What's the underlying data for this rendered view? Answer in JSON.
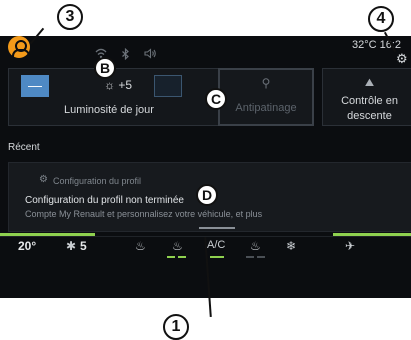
{
  "callouts": {
    "n3": "3",
    "n4": "4",
    "b": "B",
    "c": "C",
    "d": "D",
    "n1": "1"
  },
  "status": {
    "temperature_time": "32°C 16:2",
    "icons": [
      "wifi-icon",
      "bluetooth-icon",
      "volume-icon"
    ]
  },
  "tiles": {
    "luminosity": {
      "minus": "—",
      "value": "☼ +5",
      "label": "Luminosité de jour"
    },
    "antipatinage": {
      "label": "Antipatinage"
    },
    "descente": {
      "label_line1": "Contrôle en",
      "label_line2": "descente"
    }
  },
  "recent": {
    "title": "Récent"
  },
  "card": {
    "header": "Configuration du profil",
    "title": "Configuration du profil non terminée",
    "subtitle": "Compte My Renault et personnalisez votre véhicule, et plus"
  },
  "hvac": {
    "temp_left": "20°",
    "fan_left": "5",
    "ac_label": "A/C"
  },
  "colors": {
    "accent": "#8fd14f",
    "avatar": "#f39a1a",
    "blue": "#4e89c4",
    "background": "#0b0d10"
  }
}
